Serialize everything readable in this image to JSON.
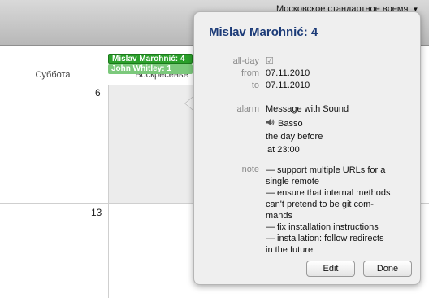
{
  "toolbar": {
    "timezone": "Московское стандартное время",
    "timezone_arrow": "▼"
  },
  "calendar": {
    "day_headers": [
      "Суббота",
      "Воскресенье"
    ],
    "dates": {
      "sun_week1": "6",
      "sat_week2": "13"
    },
    "events": [
      {
        "label": "Mislav Marohnić: 4",
        "color": "#2ba02b"
      },
      {
        "label": "John Whitley: 1",
        "color": "#7cc97c"
      }
    ]
  },
  "popover": {
    "title": "Mislav Marohnić: 4",
    "allday_label": "all-day",
    "allday_checked": "☑",
    "from_label": "from",
    "from_value": "07.11.2010",
    "to_label": "to",
    "to_value": "07.11.2010",
    "alarm_label": "alarm",
    "alarm_type": "Message with Sound",
    "alarm_sound": "Basso",
    "alarm_when": "the day before",
    "alarm_time": "at 23:00",
    "note_label": "note",
    "note_lines": [
      "— support multiple URLs for a",
      "single remote",
      "— ensure that internal methods",
      "can't pretend to be git com-",
      "mands",
      "— fix installation instructions",
      "— installation: follow redirects",
      "in the future"
    ],
    "edit_label": "Edit",
    "done_label": "Done"
  }
}
